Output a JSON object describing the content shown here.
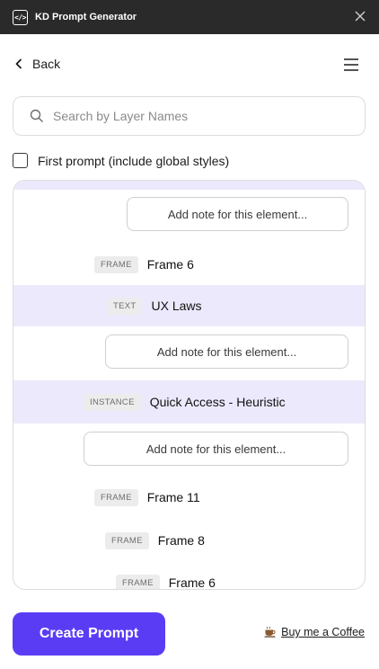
{
  "window": {
    "title": "KD Prompt Generator",
    "icon_text": "</>"
  },
  "nav": {
    "back_label": "Back"
  },
  "search": {
    "placeholder": "Search by Layer Names"
  },
  "options": {
    "first_prompt_label": "First prompt (include global styles)",
    "first_prompt_checked": false
  },
  "layers": {
    "note_placeholder": "Add note for this element...",
    "items": [
      {
        "type": "FRAME",
        "name": "Frame 6",
        "highlighted": false
      },
      {
        "type": "TEXT",
        "name": "UX Laws",
        "highlighted": true
      },
      {
        "type": "INSTANCE",
        "name": "Quick Access - Heuristic",
        "highlighted": true
      },
      {
        "type": "FRAME",
        "name": "Frame 11",
        "highlighted": false
      },
      {
        "type": "FRAME",
        "name": "Frame 8",
        "highlighted": false
      },
      {
        "type": "FRAME",
        "name": "Frame 6",
        "highlighted": false
      }
    ]
  },
  "footer": {
    "create_label": "Create Prompt",
    "coffee_label": "Buy me a Coffee"
  },
  "colors": {
    "accent": "#5b3cf5",
    "highlight": "#ede9fc",
    "titlebar": "#2a2a2a"
  },
  "icons": [
    "code-icon",
    "close-icon",
    "chevron-left-icon",
    "menu-icon",
    "search-icon",
    "coffee-icon"
  ]
}
